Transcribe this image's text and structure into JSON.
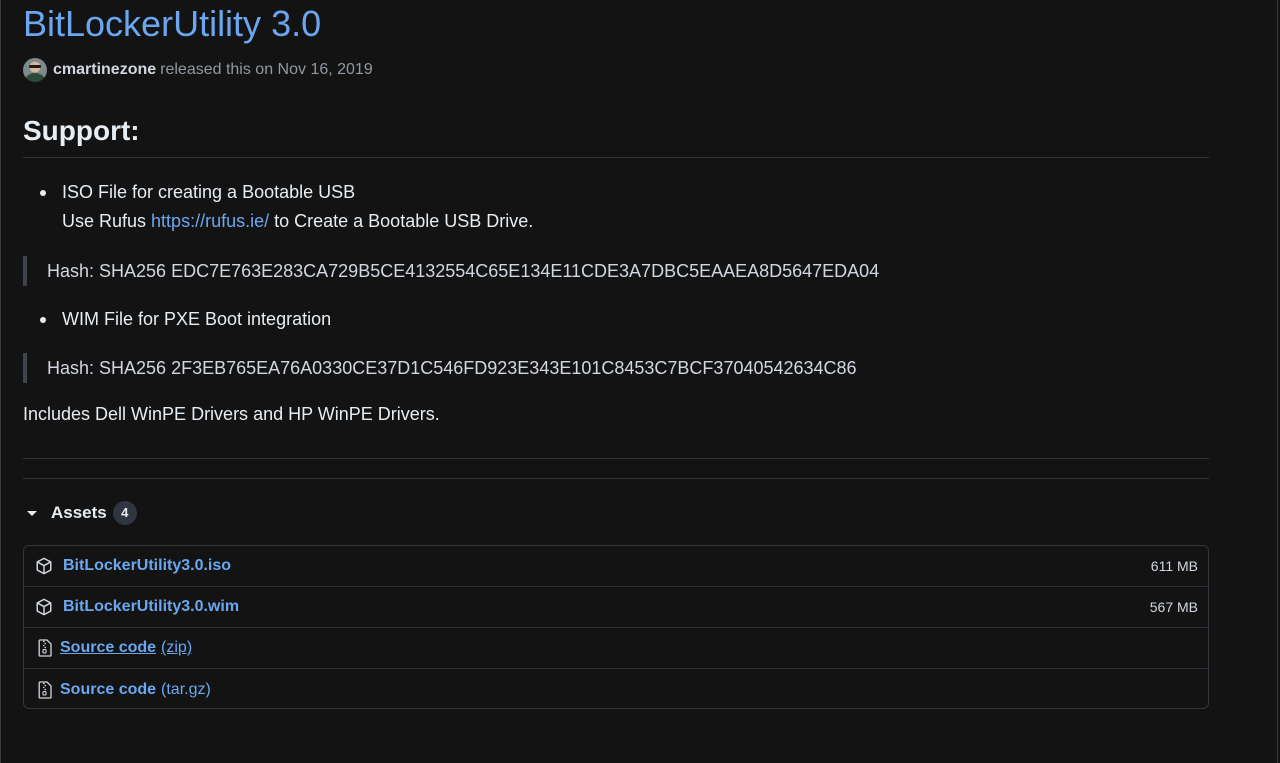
{
  "release": {
    "title": "BitLockerUtility 3.0",
    "author": "cmartinezone",
    "released_text": "released this on Nov 16, 2019"
  },
  "notes": {
    "heading": "Support:",
    "items": [
      {
        "line1": "ISO File for creating a Bootable USB",
        "line2_prefix": "Use Rufus ",
        "link": "https://rufus.ie/",
        "line2_suffix": " to Create a Bootable USB Drive.",
        "hash": "Hash: SHA256 EDC7E763E283CA729B5CE4132554C65E134E11CDE3A7DBC5EAAEA8D5647EDA04"
      },
      {
        "line1": "WIM File for PXE Boot integration",
        "hash": "Hash: SHA256 2F3EB765EA76A0330CE37D1C546FD923E343E101C8453C7BCF37040542634C86"
      }
    ],
    "footer": "Includes Dell WinPE Drivers and HP WinPE Drivers."
  },
  "assets": {
    "label": "Assets",
    "count": "4",
    "files": [
      {
        "name": "BitLockerUtility3.0.iso",
        "size": "611 MB",
        "icon": "package-icon"
      },
      {
        "name": "BitLockerUtility3.0.wim",
        "size": "567 MB",
        "icon": "package-icon"
      }
    ],
    "source": [
      {
        "name": "Source code",
        "ext": "(zip)",
        "icon": "file-zip-icon"
      },
      {
        "name": "Source code",
        "ext": "(tar.gz)",
        "icon": "file-zip-icon"
      }
    ]
  },
  "colors": {
    "background": "#131313",
    "link": "#6aa7f0",
    "text": "#e6edf3",
    "muted": "#9198a1"
  }
}
